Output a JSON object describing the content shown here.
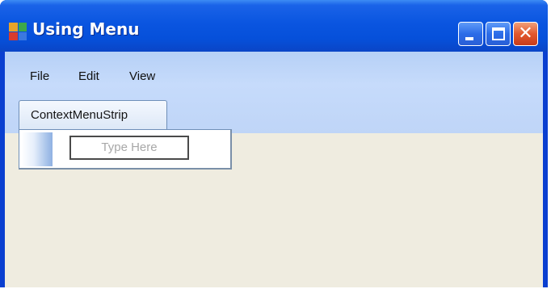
{
  "window": {
    "title": "Using Menu",
    "controls": {
      "minimize_icon": "minimize-icon",
      "maximize_icon": "maximize-icon",
      "close_icon": "close-icon"
    }
  },
  "menubar": {
    "items": [
      {
        "label": "File"
      },
      {
        "label": "Edit"
      },
      {
        "label": "View"
      }
    ]
  },
  "context_menu": {
    "tab_label": "ContextMenuStrip",
    "type_here": "Type Here"
  },
  "colors": {
    "titlebar": "#0a55e0",
    "client_bg": "#efece0",
    "menubar": "#c6dbfb",
    "close_button": "#e2582e"
  }
}
